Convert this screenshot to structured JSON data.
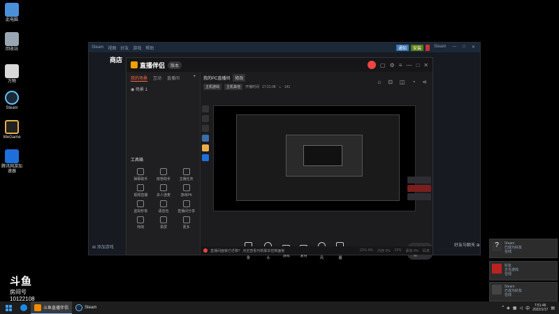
{
  "desktop": {
    "icons": [
      {
        "label": "此电脑"
      },
      {
        "label": "回收站"
      },
      {
        "label": "万物"
      },
      {
        "label": "Steam"
      },
      {
        "label": "WeGame"
      },
      {
        "label": "腾讯网游加速器"
      }
    ]
  },
  "steam": {
    "menu": [
      "Steam",
      "视图",
      "好友",
      "游戏",
      "帮助"
    ],
    "nav_item": "商店",
    "buttons": {
      "announce": "通知",
      "install": "安装"
    },
    "user": "Steam",
    "add_game": "添加游戏",
    "friends_chat": "好友与聊天"
  },
  "broadcast": {
    "app_name": "直播伴侣",
    "version_pill": "版本",
    "left_tabs": [
      "我的场景",
      "互动",
      "直播间"
    ],
    "scene_label": "场景 1",
    "tools_title": "工具箱",
    "tools": [
      "弹幕助手",
      "房管助手",
      "主播任务",
      "视频直播",
      "多人连麦",
      "游戏PK",
      "虚拟形象",
      "语音包",
      "直播间分享",
      "特效",
      "录屏",
      "更多"
    ],
    "room_title": "我的PC直播间",
    "edit_label": "修改",
    "tags": [
      "主机游戏",
      "主机其他"
    ],
    "meta": [
      "开播时间",
      "17:21:08"
    ],
    "likes": "141",
    "bottom_controls": [
      "直播背景",
      "摄像头",
      "游戏",
      "素材",
      "麦克风",
      "扬声器"
    ],
    "start_button": "开始直播",
    "status_hint": "直播间面板已迁移？ 点击查看可新版本控制面板",
    "status_stats": [
      "CPU 0%",
      "内存 2%",
      "FPS",
      "丢帧 0%",
      "码率"
    ]
  },
  "notifications": [
    {
      "title": "Steam",
      "line1": "已成为好友",
      "line2": "在线"
    },
    {
      "title": "好友",
      "line1": "正在游戏",
      "line2": "在线"
    },
    {
      "title": "Steam",
      "line1": "已成为好友",
      "line2": "在线"
    }
  ],
  "watermark": {
    "logo": "斗鱼",
    "sub": "房间号",
    "room": "10122108"
  },
  "taskbar": {
    "items": [
      "斗鱼直播伴侣",
      "Steam"
    ],
    "time": "7:51:46",
    "date": "2022/1/17",
    "lang": "中"
  },
  "colors": {
    "accent": "#ff6b3d",
    "steam_bg": "#171a21",
    "bc_bg": "#1c1c1f",
    "taskbar": "#1d1d1d"
  }
}
